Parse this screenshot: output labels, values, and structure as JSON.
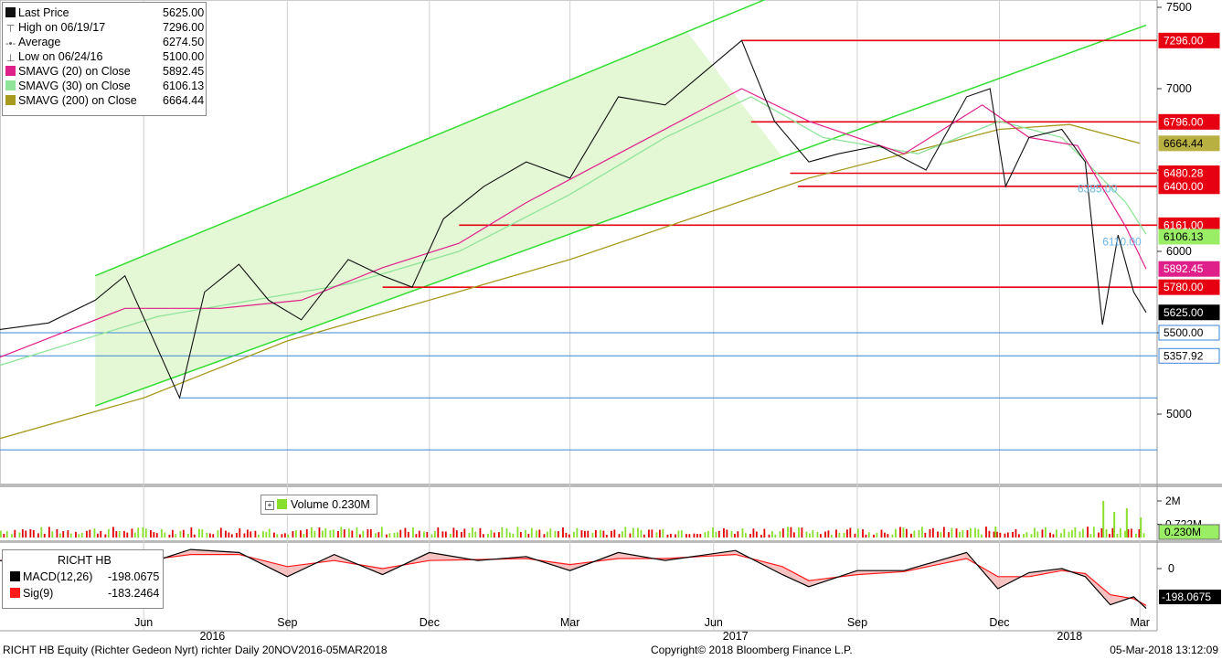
{
  "colors": {
    "channel_line": "#33dd33",
    "channel_fill": "#e4f8d6",
    "resistance": "#e60012",
    "support": "#3d86d6",
    "sma20": "#e0208a",
    "sma30": "#8fe49a",
    "sma200": "#a89a1e",
    "macd": "#000000",
    "sig": "#ff1a1a",
    "vol_up": "#88e02c",
    "vol_down": "#e00000"
  },
  "legend": {
    "rows": [
      {
        "label": "Last Price",
        "value": "5625.00",
        "swatch": "#111111"
      },
      {
        "label": "High on 06/19/17",
        "value": "7296.00",
        "swatch": ""
      },
      {
        "label": "Average",
        "value": "6274.50",
        "swatch": ""
      },
      {
        "label": "Low on 06/24/16",
        "value": "5100.00",
        "swatch": ""
      },
      {
        "label": "SMAVG (20) on Close",
        "value": "5892.45",
        "swatch": "#e0208a"
      },
      {
        "label": "SMAVG (30) on Close",
        "value": "6106.13",
        "swatch": "#8fe49a"
      },
      {
        "label": "SMAVG (200) on Close",
        "value": "6664.44",
        "swatch": "#a89a1e"
      }
    ]
  },
  "volume_legend": {
    "label": "Volume 0.230M"
  },
  "macd_legend": {
    "title": "RICHT HB",
    "macd_label": "MACD(12,26)",
    "macd_value": "-198.0675",
    "sig_label": "Sig(9)",
    "sig_value": "-183.2464"
  },
  "footer": {
    "left": "RICHT HB Equity (Richter Gedeon Nyrt) richter  Daily 20NOV2016-05MAR2018",
    "center": "Copyright© 2018 Bloomberg Finance L.P.",
    "right": "05-Mar-2018 13:12:09"
  },
  "chart_data": [
    {
      "type": "line",
      "title": "",
      "y_ticks": [
        "7500",
        "7000",
        "6500",
        "6000",
        "5500",
        "5000"
      ],
      "ylim": [
        4750,
        7500
      ],
      "x_ticks": [
        {
          "label": "Jun",
          "date": "2016-06-01"
        },
        {
          "label": "Sep",
          "date": "2016-09-01"
        },
        {
          "label": "Dec",
          "date": "2016-12-01"
        },
        {
          "label": "Mar",
          "date": "2017-03-01"
        },
        {
          "label": "Jun",
          "date": "2017-06-01"
        },
        {
          "label": "Sep",
          "date": "2017-09-01"
        },
        {
          "label": "Dec",
          "date": "2017-12-01"
        },
        {
          "label": "Mar",
          "date": "2018-03-01"
        }
      ],
      "year_labels": [
        {
          "label": "2016",
          "date": "2016-07-15"
        },
        {
          "label": "2017",
          "date": "2017-06-15"
        },
        {
          "label": "2018",
          "date": "2018-01-15"
        }
      ],
      "series": [
        {
          "name": "Last Price",
          "x": [
            "2016-03-01",
            "2016-04-01",
            "2016-05-01",
            "2016-05-20",
            "2016-06-24",
            "2016-07-10",
            "2016-08-01",
            "2016-08-20",
            "2016-09-10",
            "2016-10-10",
            "2016-11-01",
            "2016-11-20",
            "2016-12-10",
            "2017-01-05",
            "2017-02-01",
            "2017-03-01",
            "2017-04-01",
            "2017-05-01",
            "2017-06-19",
            "2017-07-10",
            "2017-08-01",
            "2017-08-20",
            "2017-09-15",
            "2017-10-15",
            "2017-11-10",
            "2017-11-25",
            "2017-12-05",
            "2017-12-20",
            "2018-01-10",
            "2018-01-25",
            "2018-02-05",
            "2018-02-15",
            "2018-02-25",
            "2018-03-05"
          ],
          "values": [
            5520,
            5560,
            5700,
            5850,
            5100,
            5750,
            5920,
            5700,
            5580,
            5950,
            5850,
            5780,
            6200,
            6400,
            6550,
            6450,
            6950,
            6900,
            7296,
            6800,
            6550,
            6600,
            6650,
            6500,
            6950,
            7000,
            6400,
            6700,
            6750,
            6550,
            5550,
            6100,
            5750,
            5625
          ]
        },
        {
          "name": "SMAVG (20) on Close",
          "x": [
            "2016-03-01",
            "2016-05-20",
            "2016-07-20",
            "2016-09-10",
            "2016-11-01",
            "2016-12-20",
            "2017-02-01",
            "2017-04-01",
            "2017-06-19",
            "2017-08-01",
            "2017-10-01",
            "2017-11-20",
            "2017-12-20",
            "2018-01-20",
            "2018-02-20",
            "2018-03-05"
          ],
          "values": [
            5350,
            5650,
            5650,
            5700,
            5900,
            6050,
            6300,
            6600,
            7000,
            6800,
            6600,
            6900,
            6700,
            6650,
            6150,
            5892
          ]
        },
        {
          "name": "SMAVG (30) on Close",
          "x": [
            "2016-03-01",
            "2016-06-10",
            "2016-08-10",
            "2016-10-10",
            "2016-12-20",
            "2017-03-01",
            "2017-05-01",
            "2017-06-25",
            "2017-08-10",
            "2017-10-10",
            "2017-12-01",
            "2018-01-10",
            "2018-02-20",
            "2018-03-05"
          ],
          "values": [
            5300,
            5600,
            5700,
            5800,
            6000,
            6350,
            6700,
            6950,
            6700,
            6600,
            6800,
            6700,
            6300,
            6106
          ]
        },
        {
          "name": "SMAVG (200) on Close",
          "x": [
            "2016-03-01",
            "2016-06-01",
            "2016-09-01",
            "2016-12-01",
            "2017-03-01",
            "2017-06-01",
            "2017-08-01",
            "2017-10-01",
            "2017-12-01",
            "2018-01-15",
            "2018-03-01"
          ],
          "values": [
            4850,
            5100,
            5450,
            5700,
            5950,
            6250,
            6450,
            6600,
            6750,
            6780,
            6664
          ]
        }
      ],
      "channel": {
        "lower_start": [
          5050,
          "2016-05-01"
        ],
        "lower_end": [
          6580,
          "2017-07-15"
        ],
        "upper_start": [
          5850,
          "2016-05-01"
        ],
        "upper_end": [
          7350,
          "2017-05-15"
        ],
        "extend_to": "2018-03-05"
      },
      "horizontal_lines": [
        {
          "value": 7296,
          "label": "7296.00",
          "kind": "resistance",
          "start": "2017-06-19"
        },
        {
          "value": 6796,
          "label": "6796.00",
          "kind": "resistance",
          "start": "2017-06-25"
        },
        {
          "value": 6480.28,
          "label": "6480.28",
          "kind": "resistance",
          "start": "2017-07-20"
        },
        {
          "value": 6400,
          "label": "6400.00",
          "kind": "resistance",
          "start": "2017-07-25"
        },
        {
          "value": 6161,
          "label": "6161.00",
          "kind": "resistance",
          "start": "2016-12-20"
        },
        {
          "value": 5780,
          "label": "5780.00",
          "kind": "resistance",
          "start": "2016-11-01"
        },
        {
          "value": 5500,
          "label": "5500.00",
          "kind": "support",
          "start": "2016-03-01"
        },
        {
          "value": 5357.92,
          "label": "5357.92",
          "kind": "support",
          "start": "2016-03-01"
        },
        {
          "value": 5100,
          "label": "",
          "kind": "support",
          "start": "2016-06-24"
        },
        {
          "value": 4780,
          "label": "",
          "kind": "support",
          "start": "2016-03-01"
        }
      ],
      "annotations": [
        {
          "text": "6385.00",
          "value": 6385,
          "date": "2018-01-20"
        },
        {
          "text": "6110.00",
          "value": 6060,
          "date": "2018-02-05"
        }
      ],
      "axis_tags": [
        {
          "text": "7296.00",
          "value": 7296,
          "style": "red"
        },
        {
          "text": "6796.00",
          "value": 6796,
          "style": "red"
        },
        {
          "text": "6664.44",
          "value": 6664,
          "style": "olive"
        },
        {
          "text": "6480.28",
          "value": 6480,
          "style": "red"
        },
        {
          "text": "6400.00",
          "value": 6400,
          "style": "red"
        },
        {
          "text": "6161.00",
          "value": 6161,
          "style": "red"
        },
        {
          "text": "6106.13",
          "value": 6090,
          "style": "green"
        },
        {
          "text": "5892.45",
          "value": 5892,
          "style": "magenta"
        },
        {
          "text": "5780.00",
          "value": 5780,
          "style": "red"
        },
        {
          "text": "5625.00",
          "value": 5625,
          "style": "black"
        },
        {
          "text": "5500.00",
          "value": 5500,
          "style": "blue"
        },
        {
          "text": "5357.92",
          "value": 5358,
          "style": "blue"
        }
      ]
    },
    {
      "type": "bar",
      "title": "Volume",
      "y_ticks": [
        "2M",
        "0.722M"
      ],
      "ylim": [
        0,
        2.2
      ],
      "current": "0.230M",
      "spikes": [
        {
          "date": "2017-11-28",
          "value": 0.6
        },
        {
          "date": "2018-02-05",
          "value": 2.0
        },
        {
          "date": "2018-02-12",
          "value": 1.4
        },
        {
          "date": "2018-02-20",
          "value": 1.6
        },
        {
          "date": "2018-03-01",
          "value": 1.1
        }
      ]
    },
    {
      "type": "line",
      "title": "RICHT HB",
      "y_ticks": [
        "0"
      ],
      "ylim": [
        -240,
        120
      ],
      "series": [
        {
          "name": "MACD(12,26)",
          "x": [
            "2016-03-01",
            "2016-04-10",
            "2016-05-10",
            "2016-06-01",
            "2016-07-01",
            "2016-08-01",
            "2016-09-01",
            "2016-10-01",
            "2016-11-01",
            "2016-12-01",
            "2017-01-01",
            "2017-02-01",
            "2017-03-01",
            "2017-04-01",
            "2017-05-01",
            "2017-06-15",
            "2017-07-15",
            "2017-08-01",
            "2017-09-01",
            "2017-10-01",
            "2017-11-10",
            "2017-11-30",
            "2017-12-20",
            "2018-01-10",
            "2018-01-25",
            "2018-02-10",
            "2018-02-25",
            "2018-03-05"
          ],
          "values": [
            40,
            30,
            90,
            20,
            95,
            80,
            -40,
            70,
            -30,
            80,
            40,
            60,
            -10,
            80,
            40,
            90,
            -30,
            -90,
            -10,
            -10,
            80,
            -100,
            -20,
            0,
            -40,
            -180,
            -140,
            -198
          ]
        },
        {
          "name": "Sig(9)",
          "x": [
            "2016-03-01",
            "2016-04-10",
            "2016-05-10",
            "2016-06-01",
            "2016-07-01",
            "2016-08-01",
            "2016-09-01",
            "2016-10-01",
            "2016-11-01",
            "2016-12-01",
            "2017-01-01",
            "2017-02-01",
            "2017-03-01",
            "2017-04-01",
            "2017-05-01",
            "2017-06-15",
            "2017-07-15",
            "2017-08-01",
            "2017-09-01",
            "2017-10-01",
            "2017-11-10",
            "2017-11-30",
            "2017-12-20",
            "2018-01-10",
            "2018-01-25",
            "2018-02-10",
            "2018-02-25",
            "2018-03-05"
          ],
          "values": [
            40,
            45,
            60,
            40,
            70,
            70,
            10,
            40,
            0,
            40,
            45,
            50,
            20,
            50,
            50,
            70,
            10,
            -60,
            -30,
            -15,
            50,
            -40,
            -40,
            -10,
            -25,
            -130,
            -150,
            -183
          ]
        }
      ],
      "current_tag": "-198.0675"
    }
  ]
}
